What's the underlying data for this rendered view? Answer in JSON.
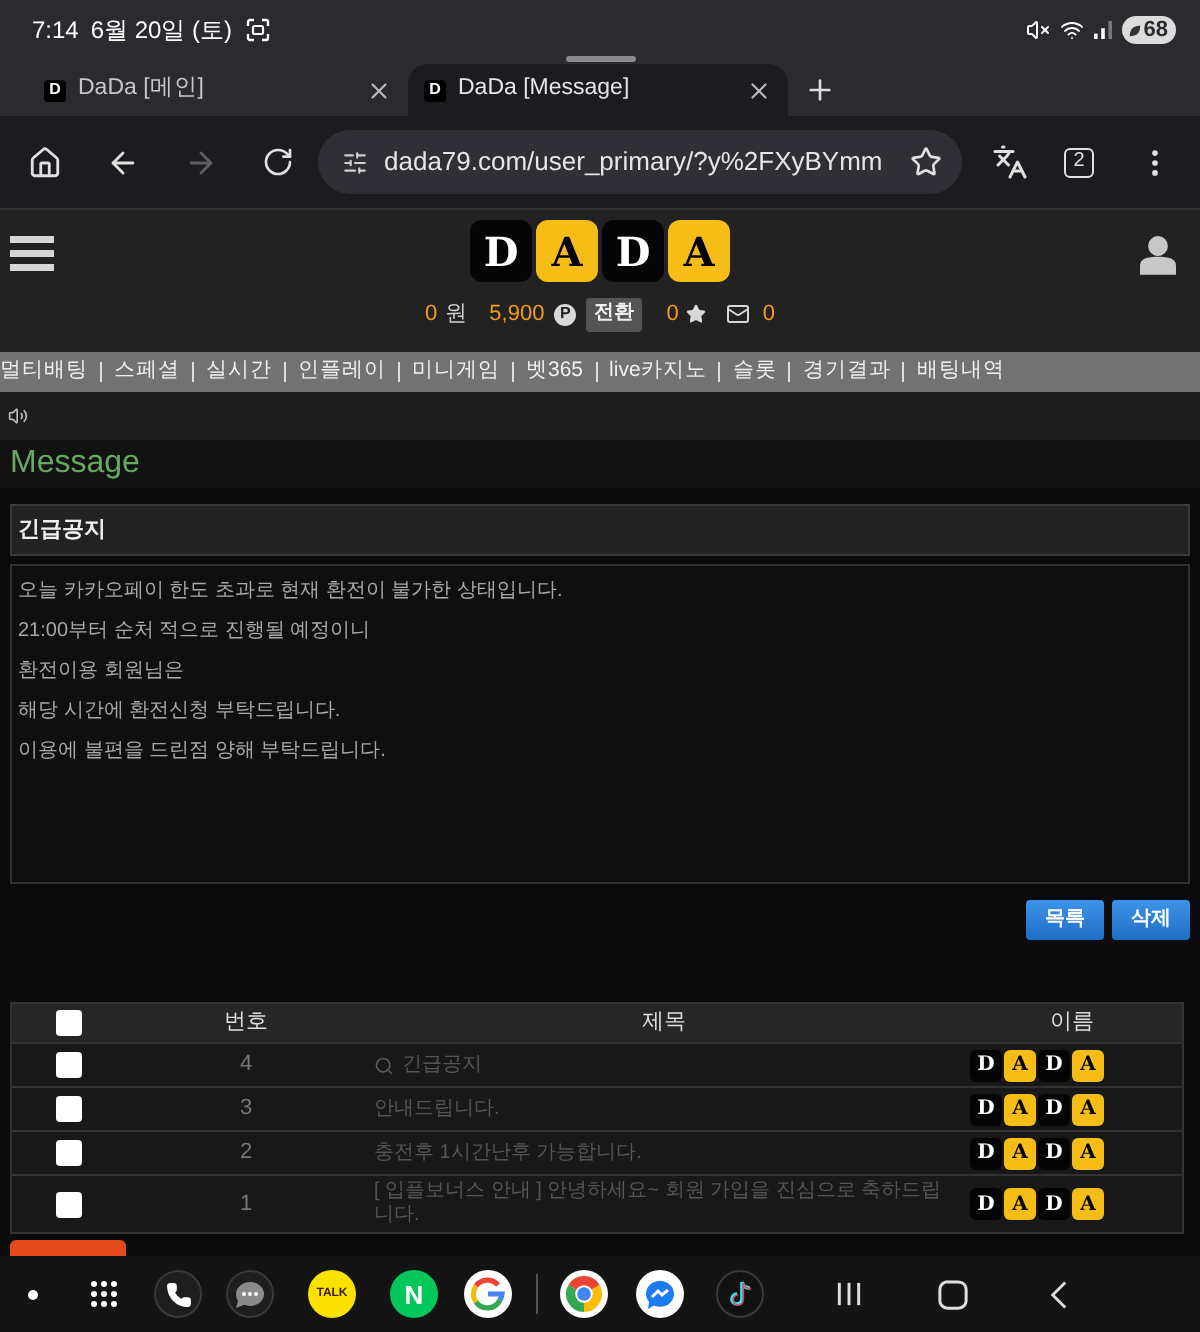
{
  "status_bar": {
    "time": "7:14",
    "date": "6월 20일 (토)",
    "battery": "68"
  },
  "browser_tabs": [
    {
      "favicon": "D",
      "title": "DaDa [메인]",
      "selected": false
    },
    {
      "favicon": "D",
      "title": "DaDa [Message]",
      "selected": true
    }
  ],
  "toolbar": {
    "forward_disabled": true,
    "url": "dada79.com/user_primary/?y%2FXyBYmm",
    "tab_count": "2"
  },
  "site_header": {
    "logo": [
      "D",
      "A",
      "D",
      "A"
    ],
    "balance": "0",
    "balance_unit": "원",
    "points": "5,900",
    "point_symbol": "P",
    "convert_button": "전환",
    "favorites": "0",
    "messages": "0"
  },
  "nav_menu": [
    "멀티배팅",
    "스페셜",
    "실시간",
    "인플레이",
    "미니게임",
    "벳365",
    "live카지노",
    "슬롯",
    "경기결과",
    "배팅내역"
  ],
  "page_title": "Message",
  "notice": {
    "title": "긴급공지",
    "lines": [
      "오늘 카카오페이 한도 초과로 현재 환전이 불가한 상태입니다.",
      "21:00부터 순처 적으로 진행될 예정이니",
      "환전이용 회원님은",
      "해당 시간에 환전신청 부탁드립니다.",
      "이용에 불편을 드린점 양해 부탁드립니다."
    ]
  },
  "actions": [
    "목록",
    "삭제"
  ],
  "table": {
    "header_checked": false,
    "columns": [
      "번호",
      "제목",
      "이름"
    ],
    "rows": [
      {
        "checked": false,
        "number": "4",
        "title": "긴급공지",
        "search_icon": true,
        "author_logo": [
          "D",
          "A",
          "D",
          "A"
        ]
      },
      {
        "checked": false,
        "number": "3",
        "title": "안내드립니다.",
        "search_icon": false,
        "author_logo": [
          "D",
          "A",
          "D",
          "A"
        ]
      },
      {
        "checked": false,
        "number": "2",
        "title": "충전후 1시간난후 가능합니다.",
        "search_icon": false,
        "author_logo": [
          "D",
          "A",
          "D",
          "A"
        ]
      },
      {
        "checked": false,
        "number": "1",
        "title": "[ 입플보너스 안내 ] 안녕하세요~ 회원 가입을 진심으로 축하드립니다.",
        "search_icon": false,
        "author_logo": [
          "D",
          "A",
          "D",
          "A"
        ]
      }
    ]
  },
  "dock": {
    "talk_label": "TALK",
    "n_label": "N"
  }
}
